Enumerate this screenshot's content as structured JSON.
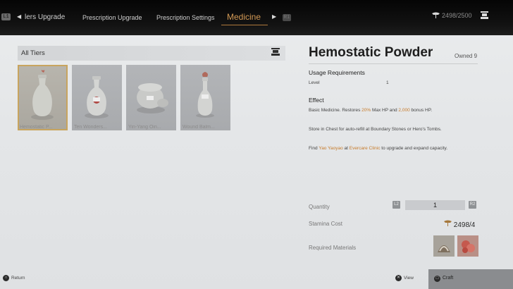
{
  "topnav": {
    "left_key": "L1",
    "right_key": "R1",
    "tabs": [
      {
        "label": "lers Upgrade"
      },
      {
        "label": "Prescription Upgrade"
      },
      {
        "label": "Prescription Settings"
      },
      {
        "label": "Medicine"
      }
    ],
    "stamina_value": "2498/2500"
  },
  "filter": {
    "label": "All Tiers"
  },
  "items": [
    {
      "name": "Hemostatic P..."
    },
    {
      "name": "Ten Wonders..."
    },
    {
      "name": "Yin-Yang Oin..."
    },
    {
      "name": "Wound Balm..."
    }
  ],
  "details": {
    "title": "Hemostatic Powder",
    "owned": "Owned 9",
    "usage_header": "Usage Requirements",
    "level_label": "Level",
    "level_value": "1",
    "effect_header": "Effect",
    "effect_pre": "Basic Medicine. Restores ",
    "effect_hp_pct": "20%",
    "effect_mid": " Max HP and ",
    "effect_bonus": "2,000",
    "effect_post": " bonus HP.",
    "store_text": "Store in Chest for auto-refill at Boundary Stones or Hero's Tombs.",
    "find_pre": "Find ",
    "find_npc": "Yao Yaoyao",
    "find_mid": " at ",
    "find_place": "Evercare Clinic",
    "find_post": " to upgrade and expand capacity."
  },
  "crafting": {
    "quantity_label": "Quantity",
    "quantity_value": "1",
    "minus_key": "L2",
    "plus_key": "R2",
    "stamina_label": "Stamina Cost",
    "stamina_value": "2498/4",
    "materials_label": "Required Materials"
  },
  "footer": {
    "return_label": "Return",
    "view_label": "View",
    "craft_label": "Craft"
  },
  "colors": {
    "accent": "#d49a55",
    "highlight": "#c77b2a"
  }
}
